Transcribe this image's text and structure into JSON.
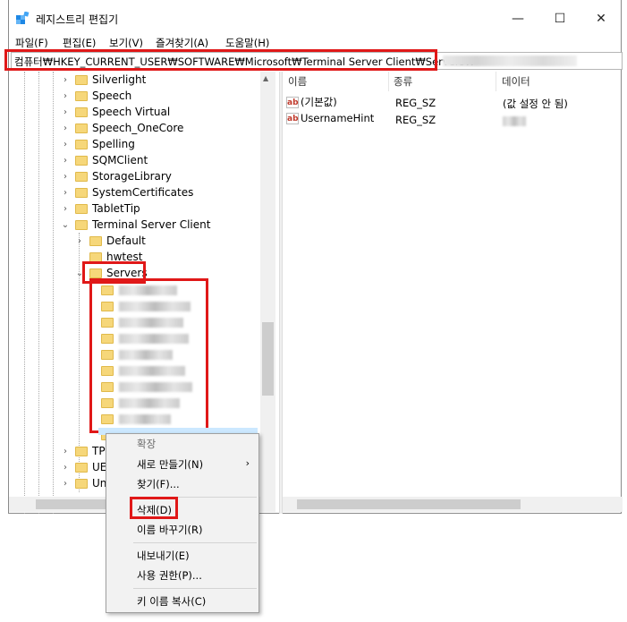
{
  "window": {
    "title": "레지스트리 편집기",
    "min_glyph": "—",
    "max_glyph": "☐",
    "close_glyph": "✕"
  },
  "menu": [
    "파일(F)",
    "편집(E)",
    "보기(V)",
    "즐겨찾기(A)",
    "도움말(H)"
  ],
  "address": "컴퓨터₩HKEY_CURRENT_USER₩SOFTWARE₩Microsoft₩Terminal Server Client₩Servers₩",
  "tree": {
    "items": [
      "Silverlight",
      "Speech",
      "Speech Virtual",
      "Speech_OneCore",
      "Spelling",
      "SQMClient",
      "StorageLibrary",
      "SystemCertificates",
      "TabletTip",
      "Terminal Server Client"
    ],
    "children": [
      "Default",
      "hwtest",
      "Servers"
    ],
    "after": [
      "TPC",
      "UEV",
      "Uni"
    ],
    "expand_glyph": "›",
    "expanded_glyph": "⌄"
  },
  "columns": {
    "name": "이름",
    "type": "종류",
    "data": "데이터"
  },
  "values": [
    {
      "name": "(기본값)",
      "type": "REG_SZ",
      "data": "(값 설정 안 됨)"
    },
    {
      "name": "UsernameHint",
      "type": "REG_SZ",
      "data": ""
    }
  ],
  "value_icon_text": "ab",
  "context_menu": {
    "expand": "확장",
    "new": "새로 만들기(N)",
    "find": "찾기(F)...",
    "delete": "삭제(D)",
    "rename": "이름 바꾸기(R)",
    "export": "내보내기(E)",
    "permissions": "사용 권한(P)...",
    "copy_key": "키 이름 복사(C)",
    "submenu_arrow": "›"
  },
  "scroll": {
    "up": "▲",
    "down": "▼",
    "left": "◀",
    "right": "▶"
  }
}
